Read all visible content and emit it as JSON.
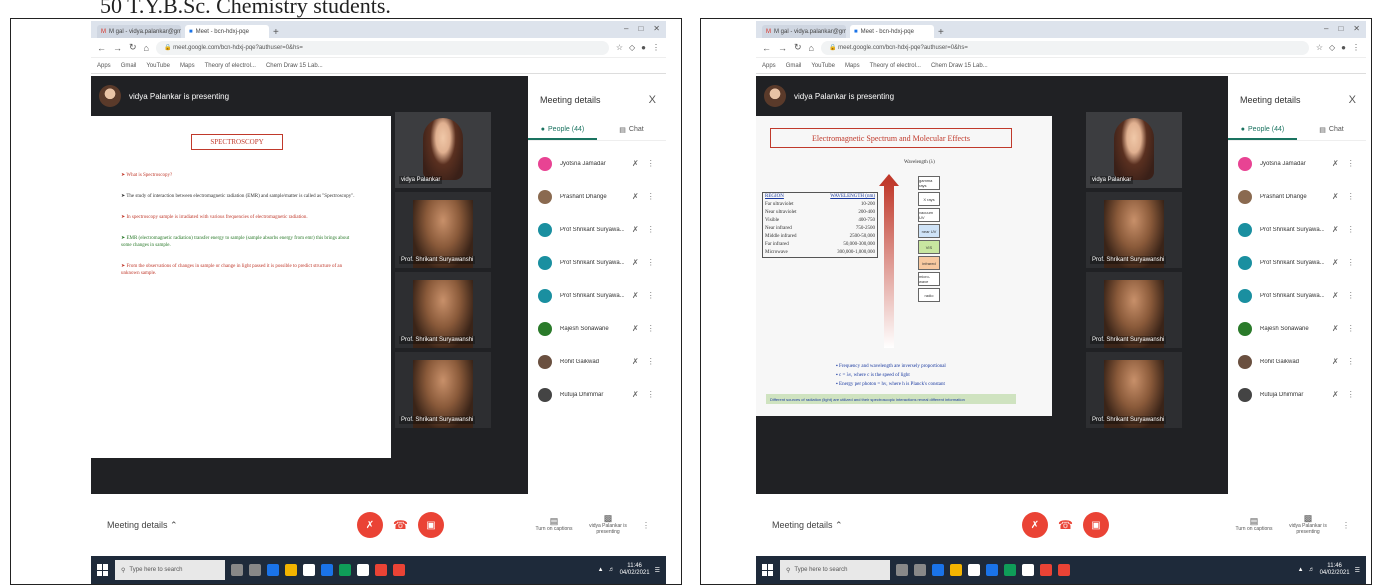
{
  "caption": "50 T.Y.B.Sc. Chemistry students.",
  "panels": [
    {
      "tabs": [
        {
          "label": "M gal - vidya.palankar@gmail.com"
        },
        {
          "label": "Meet - bcn-hdxj-pqe"
        }
      ],
      "url": "meet.google.com/bcn-hdxj-pqe?authuser=0&hs=",
      "bookmarks": [
        "Apps",
        "Gmail",
        "YouTube",
        "Maps",
        "Theory of electrol...",
        "Chem Draw 15 Lab..."
      ],
      "presenter_banner": "vidya Palankar is presenting",
      "slide": {
        "title": "SPECTROSCOPY",
        "bullets": [
          {
            "text": "What is Spectroscopy?",
            "color": "red"
          },
          {
            "text": "The study of interaction between electromagnetic radiation (EMR) and sample/matter is called as \"Spectroscopy\".",
            "color": "black"
          },
          {
            "text": "In spectroscopy sample is irradiated with various frequencies of electromagnetic radiation.",
            "color": "red"
          },
          {
            "text": "EMR (electromagnetic radiation) transfer energy to sample (sample absorbs energy from emr) this brings about some changes in sample.",
            "color": "green"
          },
          {
            "text": "From the observations of changes in sample or change in light passed it is possible to predict structure of an unknown sample.",
            "color": "red"
          }
        ]
      },
      "tiles": [
        {
          "label": "vidya Palankar",
          "presenter": true
        },
        {
          "label": "Prof. Shrikant Suryawanshi"
        },
        {
          "label": "Prof. Shrikant Suryawanshi"
        },
        {
          "label": "Prof. Shrikant Suryawanshi"
        }
      ],
      "side": {
        "title": "Meeting details",
        "tab_people": "People (44)",
        "tab_chat": "Chat",
        "people": [
          {
            "name": "Jyotsna Jamadar",
            "color": "#e84393"
          },
          {
            "name": "Prashant Dhange",
            "color": "#8a6a50"
          },
          {
            "name": "Prof Shrikant Suryawa...",
            "color": "#1a8fa0"
          },
          {
            "name": "Prof Shrikant Suryawa...",
            "color": "#1a8fa0"
          },
          {
            "name": "Prof Shrikant Suryawa...",
            "color": "#1a8fa0"
          },
          {
            "name": "Rajesh Sonawane",
            "color": "#2a7a2a"
          },
          {
            "name": "Rohit Gaikwad",
            "color": "#6a5040"
          },
          {
            "name": "Rutuja Dhimmar",
            "color": "#444"
          }
        ]
      },
      "controls": {
        "meeting_details": "Meeting details",
        "captions": "Turn on captions",
        "presenting": "vidya Palankar is presenting"
      },
      "taskbar": {
        "search": "Type here to search",
        "time": "11:46",
        "date": "04/02/2021"
      }
    },
    {
      "tabs": [
        {
          "label": "M gal - vidya.palankar@gmail.com"
        },
        {
          "label": "Meet - bcn-hdxj-pqe"
        }
      ],
      "url": "meet.google.com/bcn-hdxj-pqe?authuser=0&hs=",
      "bookmarks": [
        "Apps",
        "Gmail",
        "YouTube",
        "Maps",
        "Theory of electrol...",
        "Chem Draw 15 Lab..."
      ],
      "presenter_banner": "vidya Palankar is presenting",
      "slide": {
        "title": "Electromagnetic Spectrum and Molecular Effects",
        "wavelength_label": "Wavelength (λ)",
        "table": [
          {
            "region": "REGION",
            "range": "WAVELENGTH (nm)"
          },
          {
            "region": "Far ultraviolet",
            "range": "10-200"
          },
          {
            "region": "Near ultraviolet",
            "range": "200-400"
          },
          {
            "region": "Visible",
            "range": "400-750"
          },
          {
            "region": "Near infrared",
            "range": "750-2500"
          },
          {
            "region": "Middle infrared",
            "range": "2500-50,000"
          },
          {
            "region": "Far infrared",
            "range": "50,000-300,000"
          },
          {
            "region": "Microwave",
            "range": "300,000-1,000,000"
          }
        ],
        "regions": [
          "gamma rays",
          "X rays",
          "vacuum UV",
          "near UV",
          "VIS",
          "infrared",
          "micro-wave",
          "radio"
        ],
        "bullets": [
          "Frequency and wavelength are inversely proportional",
          "c = λν, where c is the speed of light",
          "Energy per photon = hν, where h is Planck's constant"
        ],
        "footer": "Different sources of radiation (light) are utilized and their spectroscopic interactions reveal different information"
      },
      "tiles": [
        {
          "label": "vidya Palankar",
          "presenter": true
        },
        {
          "label": "Prof. Shrikant Suryawanshi"
        },
        {
          "label": "Prof. Shrikant Suryawanshi"
        },
        {
          "label": "Prof. Shrikant Suryawanshi"
        }
      ],
      "side": {
        "title": "Meeting details",
        "tab_people": "People (44)",
        "tab_chat": "Chat",
        "people": [
          {
            "name": "Jyotsna Jamadar",
            "color": "#e84393"
          },
          {
            "name": "Prashant Dhange",
            "color": "#8a6a50"
          },
          {
            "name": "Prof Shrikant Suryawa...",
            "color": "#1a8fa0"
          },
          {
            "name": "Prof Shrikant Suryawa...",
            "color": "#1a8fa0"
          },
          {
            "name": "Prof Shrikant Suryawa...",
            "color": "#1a8fa0"
          },
          {
            "name": "Rajesh Sonawane",
            "color": "#2a7a2a"
          },
          {
            "name": "Rohit Gaikwad",
            "color": "#6a5040"
          },
          {
            "name": "Rutuja Dhimmar",
            "color": "#444"
          }
        ]
      },
      "controls": {
        "meeting_details": "Meeting details",
        "captions": "Turn on captions",
        "presenting": "vidya Palankar is presenting"
      },
      "taskbar": {
        "search": "Type here to search",
        "time": "11:46",
        "date": "04/02/2021"
      }
    }
  ]
}
